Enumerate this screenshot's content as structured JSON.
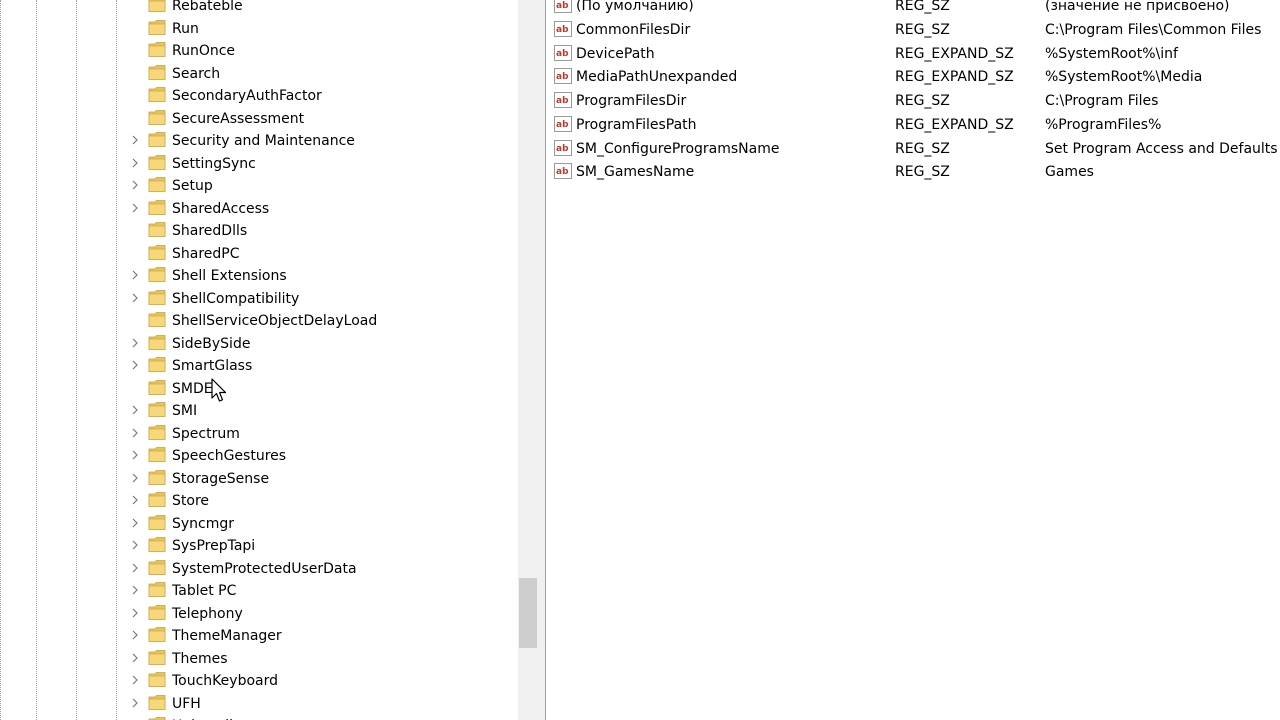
{
  "tree": {
    "items": [
      {
        "label": "Rebateble",
        "expandable": false
      },
      {
        "label": "Run",
        "expandable": false
      },
      {
        "label": "RunOnce",
        "expandable": false
      },
      {
        "label": "Search",
        "expandable": false
      },
      {
        "label": "SecondaryAuthFactor",
        "expandable": false
      },
      {
        "label": "SecureAssessment",
        "expandable": false
      },
      {
        "label": "Security and Maintenance",
        "expandable": true
      },
      {
        "label": "SettingSync",
        "expandable": true
      },
      {
        "label": "Setup",
        "expandable": true
      },
      {
        "label": "SharedAccess",
        "expandable": true
      },
      {
        "label": "SharedDlls",
        "expandable": false
      },
      {
        "label": "SharedPC",
        "expandable": false
      },
      {
        "label": "Shell Extensions",
        "expandable": true
      },
      {
        "label": "ShellCompatibility",
        "expandable": true
      },
      {
        "label": "ShellServiceObjectDelayLoad",
        "expandable": false
      },
      {
        "label": "SideBySide",
        "expandable": true
      },
      {
        "label": "SmartGlass",
        "expandable": true
      },
      {
        "label": "SMDEn",
        "expandable": false
      },
      {
        "label": "SMI",
        "expandable": true
      },
      {
        "label": "Spectrum",
        "expandable": true
      },
      {
        "label": "SpeechGestures",
        "expandable": true
      },
      {
        "label": "StorageSense",
        "expandable": true
      },
      {
        "label": "Store",
        "expandable": true
      },
      {
        "label": "Syncmgr",
        "expandable": true
      },
      {
        "label": "SysPrepTapi",
        "expandable": true
      },
      {
        "label": "SystemProtectedUserData",
        "expandable": true
      },
      {
        "label": "Tablet PC",
        "expandable": true
      },
      {
        "label": "Telephony",
        "expandable": true
      },
      {
        "label": "ThemeManager",
        "expandable": true
      },
      {
        "label": "Themes",
        "expandable": true
      },
      {
        "label": "TouchKeyboard",
        "expandable": true
      },
      {
        "label": "UFH",
        "expandable": true
      },
      {
        "label": "Uninstall",
        "expandable": true
      }
    ]
  },
  "values": {
    "rows": [
      {
        "name": "(По умолчанию)",
        "type": "REG_SZ",
        "data": "(значение не присвоено)"
      },
      {
        "name": "CommonFilesDir",
        "type": "REG_SZ",
        "data": "C:\\Program Files\\Common Files"
      },
      {
        "name": "DevicePath",
        "type": "REG_EXPAND_SZ",
        "data": "%SystemRoot%\\inf"
      },
      {
        "name": "MediaPathUnexpanded",
        "type": "REG_EXPAND_SZ",
        "data": "%SystemRoot%\\Media"
      },
      {
        "name": "ProgramFilesDir",
        "type": "REG_SZ",
        "data": "C:\\Program Files"
      },
      {
        "name": "ProgramFilesPath",
        "type": "REG_EXPAND_SZ",
        "data": "%ProgramFiles%"
      },
      {
        "name": "SM_ConfigureProgramsName",
        "type": "REG_SZ",
        "data": "Set Program Access and Defaults"
      },
      {
        "name": "SM_GamesName",
        "type": "REG_SZ",
        "data": "Games"
      }
    ],
    "icon": "ab-string-value-icon"
  },
  "colors": {
    "folder": "#e8c25a",
    "ab_icon_red": "#c0392b",
    "splitter": "#f0f0f0"
  }
}
